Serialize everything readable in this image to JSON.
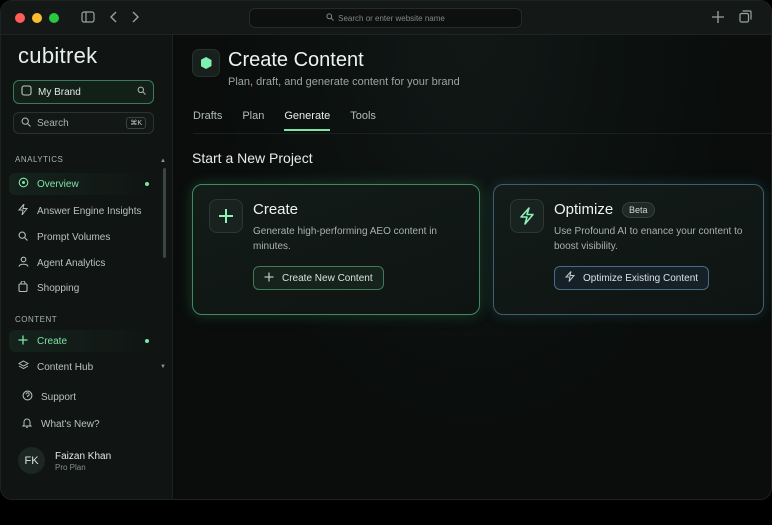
{
  "browser": {
    "url_placeholder": "Search or enter website name"
  },
  "sidebar": {
    "logo": "cubitrek",
    "brand_selector": "My Brand",
    "search_label": "Search",
    "search_shortcut": "⌘K",
    "analytics_label": "ANALYTICS",
    "analytics_items": [
      {
        "label": "Overview",
        "icon": "overview-icon"
      },
      {
        "label": "Answer Engine Insights",
        "icon": "lightning-icon"
      },
      {
        "label": "Prompt Volumes",
        "icon": "search-icon"
      },
      {
        "label": "Agent Analytics",
        "icon": "agent-icon"
      },
      {
        "label": "Shopping",
        "icon": "shopping-icon"
      }
    ],
    "content_label": "CONTENT",
    "content_items": [
      {
        "label": "Create",
        "icon": "plus-icon"
      },
      {
        "label": "Content Hub",
        "icon": "layers-icon"
      }
    ],
    "footer_items": [
      {
        "label": "Support",
        "icon": "support-icon"
      },
      {
        "label": "What's New?",
        "icon": "bell-icon"
      }
    ],
    "user": {
      "initials": "FK",
      "name": "Faizan Khan",
      "plan": "Pro Plan"
    }
  },
  "main": {
    "title": "Create Content",
    "subtitle": "Plan, draft, and generate content for your brand",
    "tabs": [
      "Drafts",
      "Plan",
      "Generate",
      "Tools"
    ],
    "active_tab": "Generate",
    "section_title": "Start a New Project",
    "cards": [
      {
        "title": "Create",
        "description": "Generate high-performing AEO content in minutes.",
        "button": "Create New Content"
      },
      {
        "title": "Optimize",
        "badge": "Beta",
        "description": "Use Profound AI to enance your content to boost visibility.",
        "button": "Optimize Existing Content"
      }
    ]
  },
  "colors": {
    "accent": "#7ee3a8",
    "background": "#0b0e0d"
  }
}
